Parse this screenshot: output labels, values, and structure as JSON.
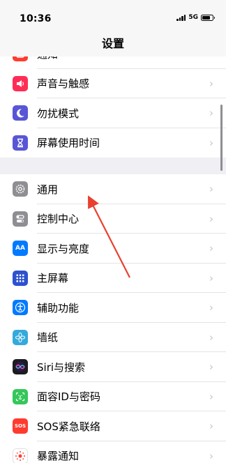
{
  "status": {
    "time": "10:36",
    "network": "5G"
  },
  "nav": {
    "title": "设置"
  },
  "group1": [
    {
      "label": "通知",
      "icon": "notifications-icon",
      "color": "#ff3b30"
    },
    {
      "label": "声音与触感",
      "icon": "speaker-icon",
      "color": "#ff2d55"
    },
    {
      "label": "勿扰模式",
      "icon": "moon-icon",
      "color": "#5856d6"
    },
    {
      "label": "屏幕使用时间",
      "icon": "hourglass-icon",
      "color": "#5856d6"
    }
  ],
  "group2": [
    {
      "label": "通用",
      "icon": "gear-icon",
      "color": "#8e8e93"
    },
    {
      "label": "控制中心",
      "icon": "toggles-icon",
      "color": "#8e8e93"
    },
    {
      "label": "显示与亮度",
      "icon": "display-aa-icon",
      "color": "#007aff"
    },
    {
      "label": "主屏幕",
      "icon": "home-grid-icon",
      "color": "#2c52d0"
    },
    {
      "label": "辅助功能",
      "icon": "accessibility-icon",
      "color": "#007aff"
    },
    {
      "label": "墙纸",
      "icon": "wallpaper-flower-icon",
      "color": "#34aadc"
    },
    {
      "label": "Siri与搜索",
      "icon": "siri-icon",
      "color": "#1c1c1e"
    },
    {
      "label": "面容ID与密码",
      "icon": "faceid-icon",
      "color": "#34c759"
    },
    {
      "label": "SOS紧急联络",
      "icon": "sos-icon",
      "color": "#ff3b30"
    },
    {
      "label": "暴露通知",
      "icon": "exposure-icon",
      "color": "#ffffff"
    }
  ],
  "icons": {
    "aa_text": "AA",
    "sos_text": "SOS"
  },
  "chevron": "›",
  "accent": {
    "arrow": "#e8412f"
  }
}
